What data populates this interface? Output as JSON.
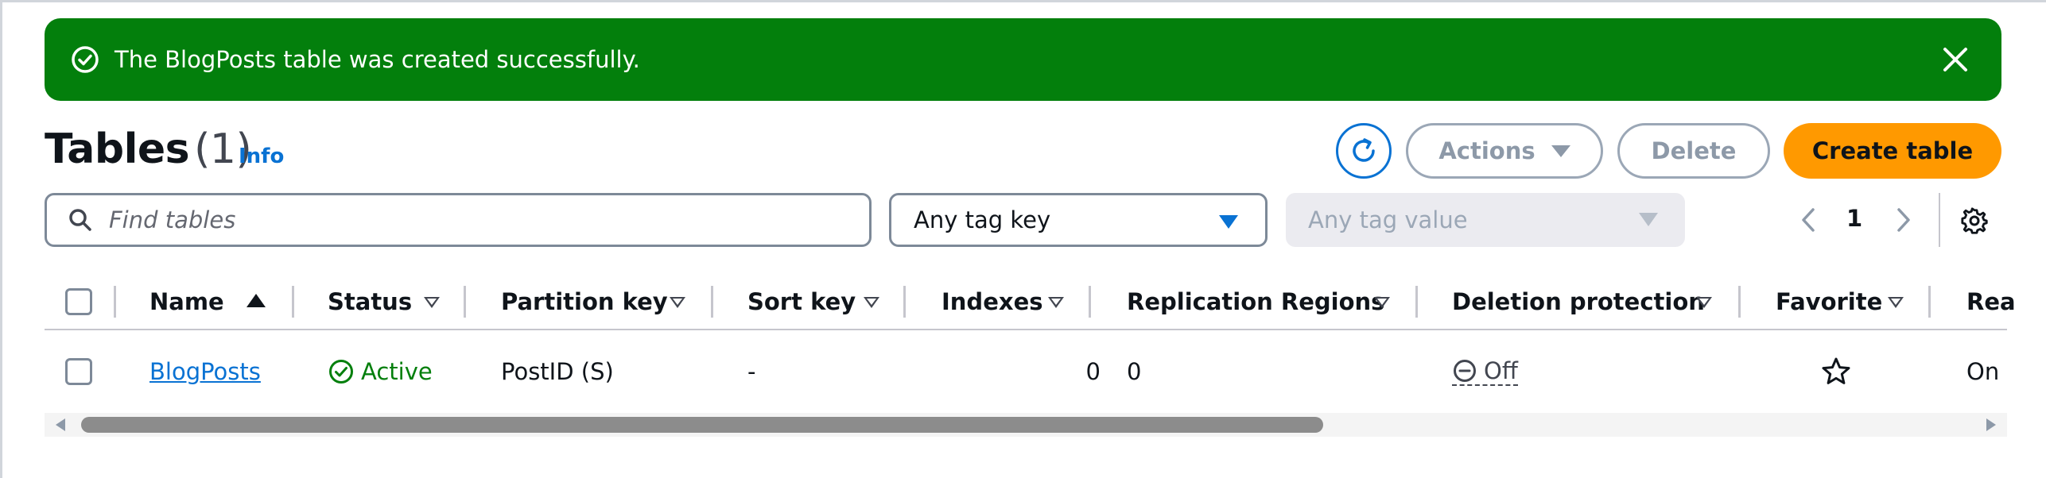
{
  "flash": {
    "message": "The BlogPosts table was created successfully.",
    "icon": "check-circle-icon",
    "close_icon": "close-icon",
    "color": "#037f0c"
  },
  "header": {
    "title": "Tables",
    "count": "(1)",
    "info_label": "Info",
    "refresh_icon": "refresh-icon",
    "actions_label": "Actions",
    "delete_label": "Delete",
    "create_label": "Create table",
    "create_color": "#ff9900"
  },
  "filters": {
    "search_placeholder": "Find tables",
    "search_value": "",
    "tag_key_value": "Any tag key",
    "tag_value_value": "Any tag value"
  },
  "pagination": {
    "current_page": "1"
  },
  "table": {
    "columns": [
      {
        "label": "Name",
        "sort": "ascending"
      },
      {
        "label": "Status",
        "sort": "none"
      },
      {
        "label": "Partition key",
        "sort": "none"
      },
      {
        "label": "Sort key",
        "sort": "none"
      },
      {
        "label": "Indexes",
        "sort": "none"
      },
      {
        "label": "Replication Regions",
        "sort": "none"
      },
      {
        "label": "Deletion protection",
        "sort": "none"
      },
      {
        "label": "Favorite",
        "sort": "none"
      },
      {
        "label": "Rea",
        "sort": "none"
      }
    ],
    "rows": [
      {
        "name": "BlogPosts",
        "status": "Active",
        "partition_key": "PostID (S)",
        "sort_key": "-",
        "indexes": "0",
        "replication_regions": "0",
        "deletion_protection": "Off",
        "favorite": "star-outline-icon",
        "read": "On"
      }
    ]
  }
}
